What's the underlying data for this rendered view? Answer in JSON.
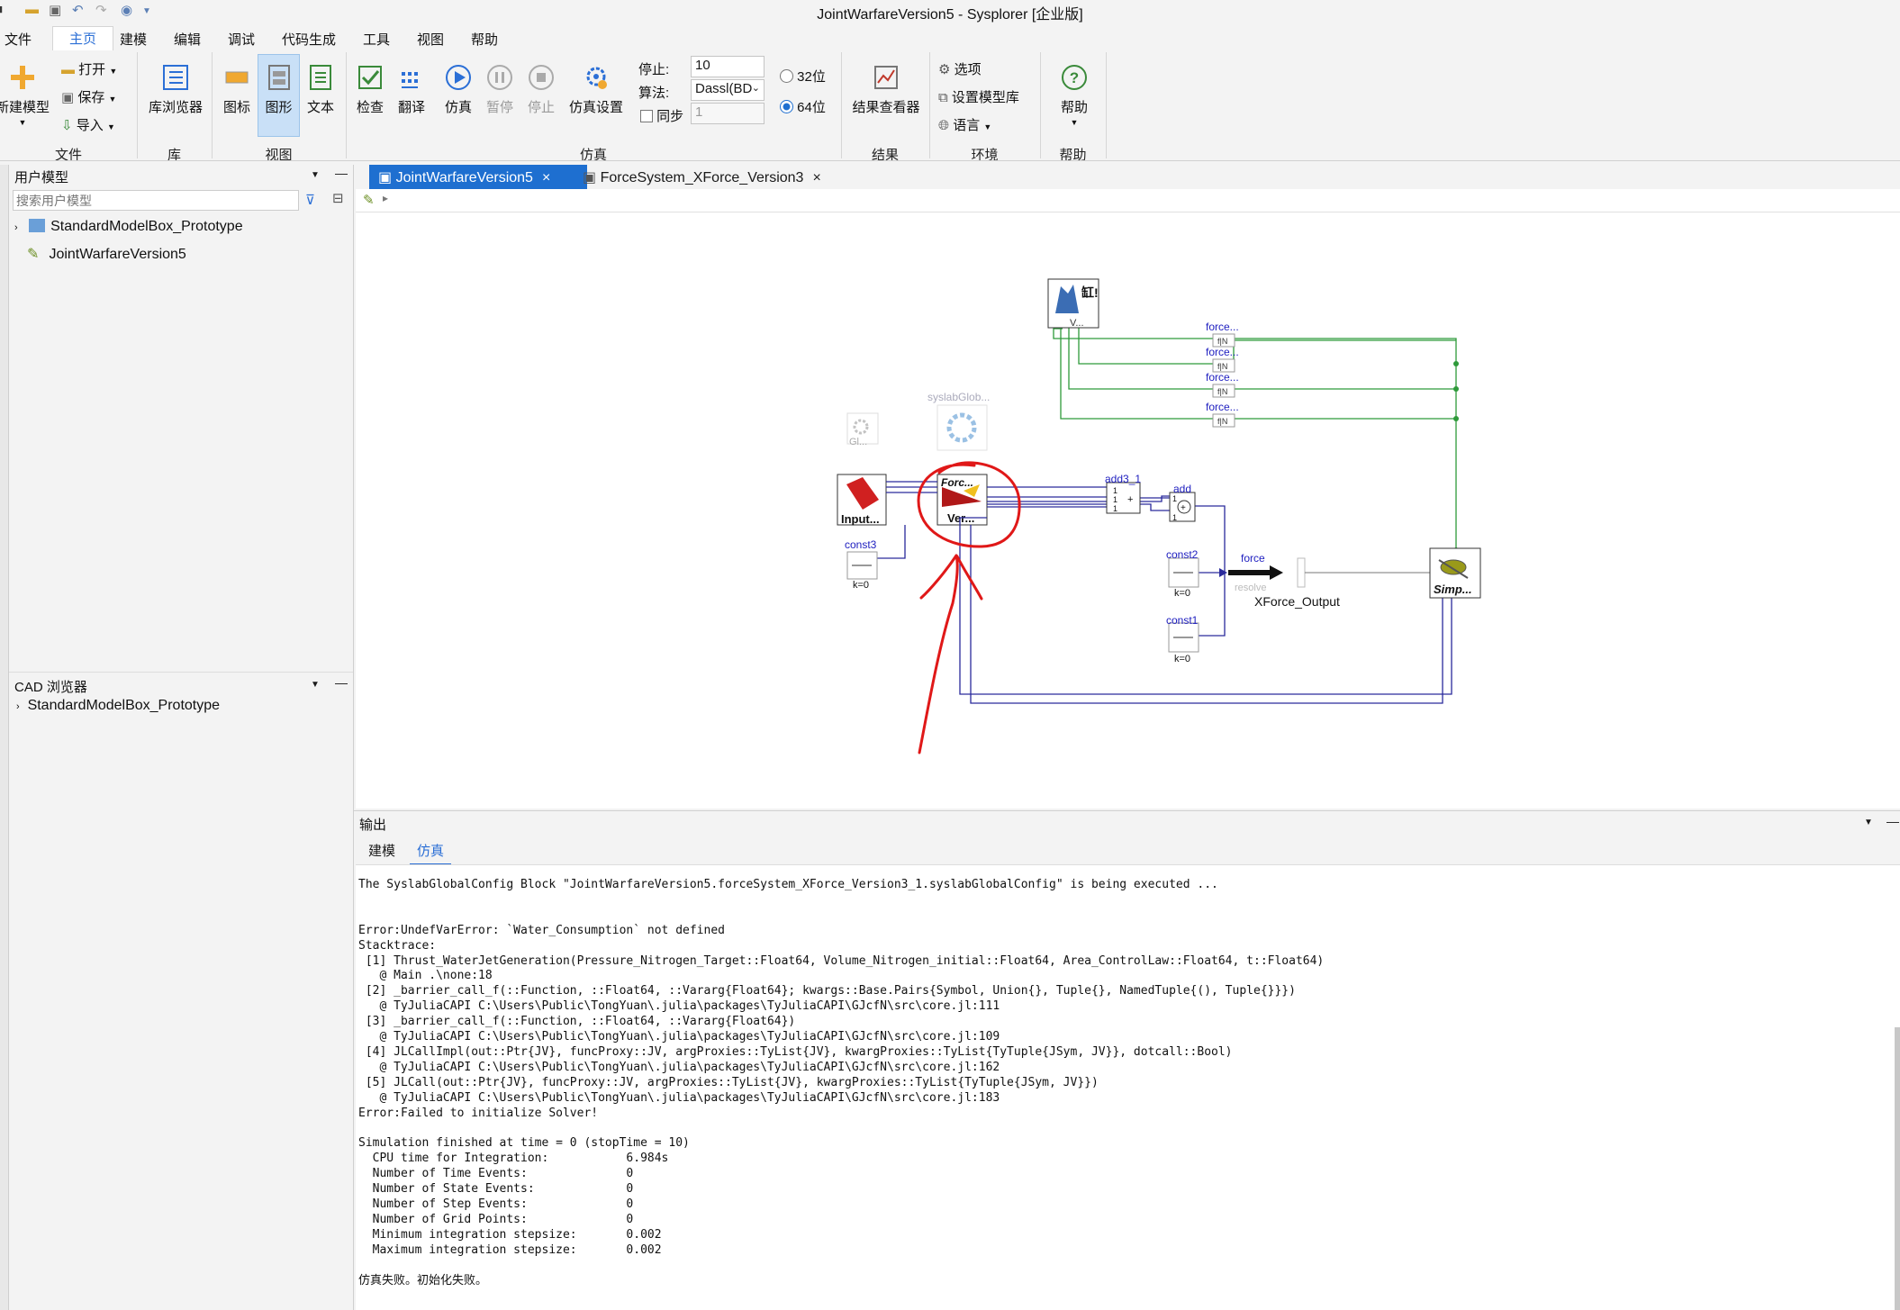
{
  "window": {
    "title": "JointWarfareVersion5 - Sysplorer [企业版]"
  },
  "menu": [
    "文件",
    "主页",
    "建模",
    "编辑",
    "调试",
    "代码生成",
    "工具",
    "视图",
    "帮助"
  ],
  "ribbon": {
    "file": {
      "new_model": "新建模型",
      "open": "打开",
      "save": "保存",
      "import": "导入",
      "group": "文件"
    },
    "lib": {
      "browser": "库浏览器",
      "group": "库"
    },
    "view": {
      "icon": "图标",
      "graphic": "图形",
      "text": "文本",
      "group": "视图"
    },
    "sim": {
      "check": "检查",
      "translate": "翻译",
      "simulate": "仿真",
      "pause": "暂停",
      "stop": "停止",
      "settings": "仿真设置",
      "stop_label": "停止:",
      "stop_value": "10",
      "algo_label": "算法:",
      "algo_value": "Dassl(BD",
      "sync_label": "同步",
      "sync_value": "1",
      "bit32": "32位",
      "bit64": "64位",
      "group": "仿真"
    },
    "result": {
      "viewer": "结果查看器",
      "group": "结果"
    },
    "env": {
      "options": "选项",
      "model_lib": "设置模型库",
      "language": "语言",
      "group": "环境"
    },
    "help": {
      "help": "帮助",
      "group": "帮助"
    }
  },
  "user_model": {
    "header": "用户模型",
    "search_placeholder": "搜索用户模型",
    "items": [
      "StandardModelBox_Prototype",
      "JointWarfareVersion5"
    ]
  },
  "cad": {
    "header": "CAD 浏览器",
    "items": [
      "StandardModelBox_Prototype"
    ]
  },
  "tabs": [
    "JointWarfareVersion5",
    "ForceSystem_XForce_Version3"
  ],
  "diagram": {
    "global_icon": "Gl...",
    "syslab_config": "syslabGlob...",
    "input_block": "Input...",
    "force_block_top": "Forc...",
    "force_block_bottom": "Ver...",
    "const3": "const3",
    "const2": "const2",
    "const1": "const1",
    "k0": "k=0",
    "add3": "add3_1",
    "add": "add",
    "force": "force",
    "resolve": "resolve",
    "xforce_output": "XForce_Output",
    "simp": "Simp...",
    "force_short": "force...",
    "visual_top": "缸!",
    "visual_bottom": "V..."
  },
  "output": {
    "header": "输出",
    "tabs": [
      "建模",
      "仿真"
    ],
    "lines": [
      "The SyslabGlobalConfig Block \"JointWarfareVersion5.forceSystem_XForce_Version3_1.syslabGlobalConfig\" is being executed ...",
      "",
      "",
      "Error:UndefVarError: `Water_Consumption` not defined",
      "Stacktrace:",
      " [1] Thrust_WaterJetGeneration(Pressure_Nitrogen_Target::Float64, Volume_Nitrogen_initial::Float64, Area_ControlLaw::Float64, t::Float64)",
      "   @ Main .\\none:18",
      " [2] _barrier_call_f(::Function, ::Float64, ::Vararg{Float64}; kwargs::Base.Pairs{Symbol, Union{}, Tuple{}, NamedTuple{(), Tuple{}}})",
      "   @ TyJuliaCAPI C:\\Users\\Public\\TongYuan\\.julia\\packages\\TyJuliaCAPI\\GJcfN\\src\\core.jl:111",
      " [3] _barrier_call_f(::Function, ::Float64, ::Vararg{Float64})",
      "   @ TyJuliaCAPI C:\\Users\\Public\\TongYuan\\.julia\\packages\\TyJuliaCAPI\\GJcfN\\src\\core.jl:109",
      " [4] JLCallImpl(out::Ptr{JV}, funcProxy::JV, argProxies::TyList{JV}, kwargProxies::TyList{TyTuple{JSym, JV}}, dotcall::Bool)",
      "   @ TyJuliaCAPI C:\\Users\\Public\\TongYuan\\.julia\\packages\\TyJuliaCAPI\\GJcfN\\src\\core.jl:162",
      " [5] JLCall(out::Ptr{JV}, funcProxy::JV, argProxies::TyList{JV}, kwargProxies::TyList{TyTuple{JSym, JV}})",
      "   @ TyJuliaCAPI C:\\Users\\Public\\TongYuan\\.julia\\packages\\TyJuliaCAPI\\GJcfN\\src\\core.jl:183",
      "Error:Failed to initialize Solver!",
      "",
      "Simulation finished at time = 0 (stopTime = 10)",
      "  CPU time for Integration:           6.984s",
      "  Number of Time Events:              0",
      "  Number of State Events:             0",
      "  Number of Step Events:              0",
      "  Number of Grid Points:              0",
      "  Minimum integration stepsize:       0.002",
      "  Maximum integration stepsize:       0.002",
      "",
      "仿真失败。初始化失败。"
    ]
  },
  "colors": {
    "accent": "#1e6fd0",
    "wire_blue": "#2a2a9c",
    "wire_green": "#2e9a3a",
    "annotation_red": "#e01818"
  }
}
